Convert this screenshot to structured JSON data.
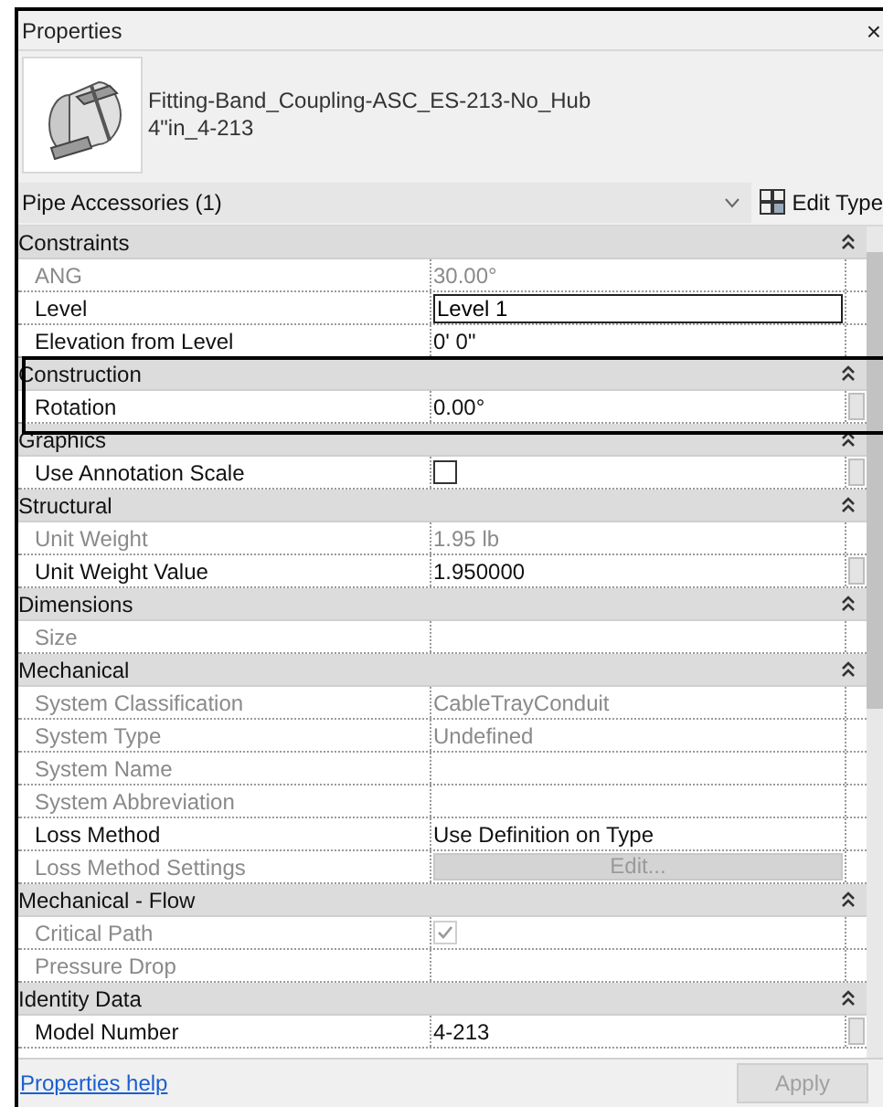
{
  "window": {
    "title": "Properties",
    "close": "×"
  },
  "type_selector": {
    "name": "Fitting-Band_Coupling-ASC_ES-213-No_Hub",
    "type": "4\"in_4-213"
  },
  "category": {
    "value": "Pipe Accessories (1)",
    "edit_type": "Edit Type"
  },
  "groups": [
    {
      "name": "Constraints",
      "expanded": true,
      "rows": [
        {
          "label": "ANG",
          "value": "30.00°",
          "kind": "text",
          "disabled": true,
          "side_button": false
        },
        {
          "label": "Level",
          "value": "Level 1",
          "kind": "input",
          "disabled": false,
          "side_button": false
        },
        {
          "label": "Elevation from Level",
          "value": "0'  0\"",
          "kind": "text",
          "disabled": false,
          "side_button": false
        }
      ]
    },
    {
      "name": "Construction",
      "expanded": true,
      "rows": [
        {
          "label": "Rotation",
          "value": "0.00°",
          "kind": "text",
          "disabled": false,
          "side_button": true
        }
      ]
    },
    {
      "name": "Graphics",
      "expanded": true,
      "rows": [
        {
          "label": "Use Annotation Scale",
          "kind": "checkbox",
          "checked": false,
          "disabled": false,
          "side_button": true
        }
      ]
    },
    {
      "name": "Structural",
      "expanded": true,
      "rows": [
        {
          "label": "Unit Weight",
          "value": "1.95 lb",
          "kind": "text",
          "disabled": true,
          "side_button": false
        },
        {
          "label": "Unit Weight Value",
          "value": "1.950000",
          "kind": "text",
          "disabled": false,
          "side_button": true
        }
      ]
    },
    {
      "name": "Dimensions",
      "expanded": true,
      "rows": [
        {
          "label": "Size",
          "kind": "text",
          "disabled": true,
          "side_button": false
        }
      ]
    },
    {
      "name": "Mechanical",
      "expanded": true,
      "rows": [
        {
          "label": "System Classification",
          "value": "CableTrayConduit",
          "kind": "text",
          "disabled": true,
          "side_button": false
        },
        {
          "label": "System Type",
          "value": "Undefined",
          "kind": "text",
          "disabled": true,
          "side_button": false
        },
        {
          "label": "System Name",
          "kind": "text",
          "disabled": true,
          "side_button": false
        },
        {
          "label": "System Abbreviation",
          "kind": "text",
          "disabled": true,
          "side_button": false
        },
        {
          "label": "Loss Method",
          "value": "Use Definition on Type",
          "kind": "text",
          "disabled": false,
          "side_button": false
        },
        {
          "label": "Loss Method Settings",
          "value": "Edit...",
          "kind": "button",
          "disabled": true,
          "side_button": false
        }
      ]
    },
    {
      "name": "Mechanical - Flow",
      "expanded": true,
      "rows": [
        {
          "label": "Critical Path",
          "kind": "checkbox",
          "checked": true,
          "disabled": true,
          "side_button": false
        },
        {
          "label": "Pressure Drop",
          "kind": "text",
          "disabled": true,
          "side_button": false
        }
      ]
    },
    {
      "name": "Identity Data",
      "expanded": true,
      "rows": [
        {
          "label": "Model Number",
          "value": "4-213",
          "kind": "text",
          "disabled": false,
          "side_button": true
        }
      ]
    }
  ],
  "footer": {
    "help_link": "Properties help",
    "apply": {
      "label": "Apply",
      "disabled": true
    }
  }
}
